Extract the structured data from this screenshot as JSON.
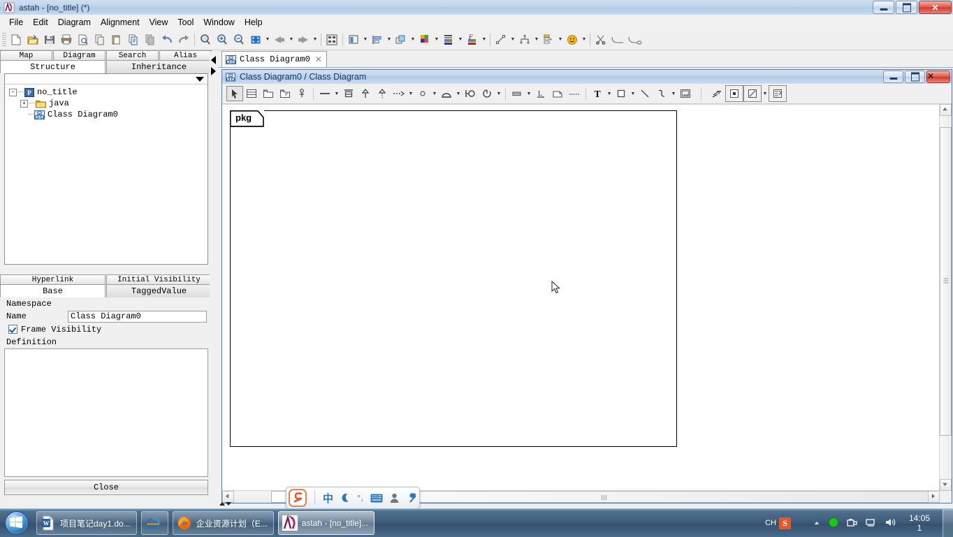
{
  "window": {
    "title": "astah - [no_title] (*)",
    "app_icon": "astah-icon",
    "minimize": "minimize-icon",
    "maximize": "restore-icon",
    "close": "close-icon"
  },
  "menubar": {
    "items": [
      {
        "label": "File"
      },
      {
        "label": "Edit"
      },
      {
        "label": "Diagram"
      },
      {
        "label": "Alignment"
      },
      {
        "label": "View"
      },
      {
        "label": "Tool"
      },
      {
        "label": "Window"
      },
      {
        "label": "Help"
      }
    ]
  },
  "toolbar": {
    "buttons": [
      {
        "name": "new-project-icon"
      },
      {
        "name": "open-project-icon"
      },
      {
        "name": "save-icon"
      },
      {
        "name": "print-icon"
      },
      {
        "name": "print-preview-icon"
      },
      {
        "name": "copy-icon"
      },
      {
        "name": "paste-icon"
      },
      {
        "name": "copy-to-clipboard-icon"
      },
      {
        "name": "paste-special-icon"
      },
      {
        "name": "undo-icon"
      },
      {
        "name": "redo-icon"
      },
      {
        "name": "zoom-icon"
      },
      {
        "name": "zoom-in-icon"
      },
      {
        "name": "zoom-out-icon"
      },
      {
        "name": "fit-to-window-icon"
      },
      {
        "name": "back-icon"
      },
      {
        "name": "forward-icon"
      },
      {
        "name": "structure-icon"
      },
      {
        "name": "layout-icon"
      },
      {
        "name": "align-icon"
      },
      {
        "name": "group-icon"
      },
      {
        "name": "color-palette-icon"
      },
      {
        "name": "fill-color-icon"
      },
      {
        "name": "font-color-icon"
      },
      {
        "name": "line-style-icon"
      },
      {
        "name": "hierarchy-icon"
      },
      {
        "name": "list-style-icon"
      },
      {
        "name": "emoticon-icon"
      },
      {
        "name": "cut-link-icon"
      },
      {
        "name": "corner-line-icon"
      },
      {
        "name": "rounded-line-icon"
      }
    ]
  },
  "sidebar": {
    "tabs_top": [
      "Map",
      "Diagram",
      "Search",
      "Alias"
    ],
    "tabs_second": [
      {
        "label": "Structure",
        "active": true
      },
      {
        "label": "Inheritance",
        "active": false
      }
    ],
    "tree": [
      {
        "label": "no_title",
        "icon": "project-icon",
        "expander": "-",
        "indent": 0
      },
      {
        "label": "java",
        "icon": "folder-icon",
        "expander": "+",
        "indent": 1
      },
      {
        "label": "Class Diagram0",
        "icon": "class-diagram-icon",
        "expander": "",
        "indent": 1
      }
    ]
  },
  "properties": {
    "tabs_top": [
      "Hyperlink",
      "Initial Visibility"
    ],
    "tabs_second": [
      {
        "label": "Base",
        "active": true
      },
      {
        "label": "TaggedValue",
        "active": false
      }
    ],
    "namespace_label": "Namespace",
    "namespace_value": "",
    "name_label": "Name",
    "name_value": "Class Diagram0",
    "frame_visibility_label": "Frame Visibility",
    "frame_visibility_checked": true,
    "definition_label": "Definition",
    "definition_value": "",
    "close_button": "Close"
  },
  "document": {
    "tab_label": "Class Diagram0",
    "tab_icon": "class-diagram-icon",
    "tab_close": "close-icon",
    "inner_title": "Class Diagram0 / Class Diagram",
    "inner_minimize": "minimize-icon",
    "inner_maximize": "restore-icon",
    "inner_close": "close-icon"
  },
  "diagram_toolbar": {
    "buttons": [
      {
        "name": "select-tool-icon",
        "selected": true
      },
      {
        "name": "class-icon"
      },
      {
        "name": "package-icon"
      },
      {
        "name": "subsystem-icon"
      },
      {
        "name": "lollipop-icon"
      },
      {
        "name": "association-icon",
        "dropdown": true
      },
      {
        "name": "attribute-icon"
      },
      {
        "name": "generalization-icon"
      },
      {
        "name": "realization-icon"
      },
      {
        "name": "dependency-icon",
        "dropdown": true
      },
      {
        "name": "interface-small-icon",
        "dropdown": true
      },
      {
        "name": "usecase-icon",
        "dropdown": true
      },
      {
        "name": "port-icon"
      },
      {
        "name": "required-interface-icon",
        "dropdown": true
      },
      {
        "name": "instance-icon",
        "dropdown": true
      },
      {
        "name": "underline-icon"
      },
      {
        "name": "note-icon"
      },
      {
        "name": "note-anchor-icon"
      },
      {
        "name": "text-icon",
        "dropdown": true
      },
      {
        "name": "rectangle-icon",
        "dropdown": true
      },
      {
        "name": "line-icon"
      },
      {
        "name": "freehand-icon",
        "dropdown": true
      },
      {
        "name": "image-icon"
      },
      {
        "name": "stereotype-icon"
      },
      {
        "name": "frame-icon"
      },
      {
        "name": "connector-icon",
        "dropdown": true
      },
      {
        "name": "auto-layout-icon"
      }
    ]
  },
  "canvas": {
    "frame_label": "pkg",
    "cursor": "arrow-pointer"
  },
  "ime": {
    "logo": "sogou-logo-icon",
    "items": [
      {
        "name": "chinese-mode-icon",
        "glyph": "中"
      },
      {
        "name": "halfwidth-icon",
        "glyph": "☽"
      },
      {
        "name": "punctuation-icon",
        "glyph": "°,"
      },
      {
        "name": "soft-keyboard-icon",
        "glyph": "keyboard"
      },
      {
        "name": "user-icon",
        "glyph": "person"
      },
      {
        "name": "settings-icon",
        "glyph": "wrench"
      }
    ]
  },
  "taskbar": {
    "start_button": "windows-start-orb",
    "items": [
      {
        "label": "项目笔记day1.do...",
        "icon": "word-document-icon"
      },
      {
        "label": "",
        "icon": "internet-explorer-icon"
      },
      {
        "label": "企业资源计划（E...",
        "icon": "firefox-icon"
      },
      {
        "label": "astah - [no_title]...",
        "icon": "astah-icon"
      }
    ],
    "tray": {
      "language": "CH",
      "sogou": "S",
      "show_hidden": "chevron-up-icon",
      "icons": [
        "green-circle-icon",
        "safe-removal-icon",
        "network-icon",
        "volume-icon"
      ],
      "time": "14:05",
      "date": "1"
    }
  },
  "colors": {
    "title_bar": "#bed3ec",
    "taskbar": "#3c5a78",
    "accent": "#16559a",
    "close_red": "#cf3a2d"
  }
}
